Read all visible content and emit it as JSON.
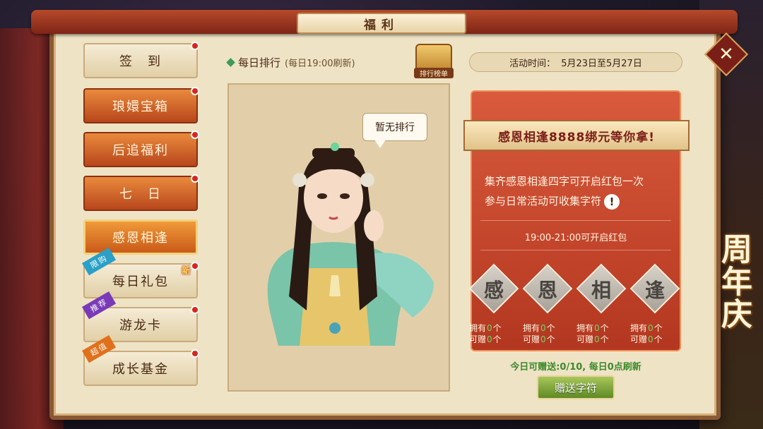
{
  "window": {
    "title": "福利"
  },
  "sidebar": {
    "items": [
      {
        "label": "签　到",
        "style": "plain",
        "dot": true,
        "tag": "",
        "new": false
      },
      {
        "label": "琅嬛宝箱",
        "style": "orange",
        "dot": true,
        "tag": "",
        "new": false
      },
      {
        "label": "后追福利",
        "style": "orange",
        "dot": true,
        "tag": "",
        "new": false
      },
      {
        "label": "七　日",
        "style": "orange",
        "dot": true,
        "tag": "",
        "new": false
      },
      {
        "label": "感恩相逢",
        "style": "active",
        "dot": false,
        "tag": "",
        "new": false
      },
      {
        "label": "每日礼包",
        "style": "plain",
        "dot": true,
        "tag": "限购",
        "tag_color": "#2aa0c8",
        "new": true,
        "new_label": "新"
      },
      {
        "label": "游龙卡",
        "style": "plain",
        "dot": true,
        "tag": "推荐",
        "tag_color": "#7a3ab8",
        "new": false
      },
      {
        "label": "成长基金",
        "style": "plain",
        "dot": true,
        "tag": "超值",
        "tag_color": "#e0701c",
        "new": false
      }
    ]
  },
  "ranking": {
    "header": "每日排行",
    "subheader": "(每日19:00刷新)",
    "rank_list_label": "排行榜单",
    "empty_text": "暂无排行"
  },
  "activity": {
    "time_label": "活动时间：",
    "time_value": "5月23日至5月27日",
    "banner": "感恩相逢8888绑元等你拿!",
    "desc_line1": "集齐感恩相逢四字可开启红包一次",
    "desc_line2": "参与日常活动可收集字符",
    "open_time": "19:00-21:00可开启红包",
    "chars": [
      {
        "glyph": "感",
        "own_label": "拥有",
        "own": 0,
        "gift_label": "可赠",
        "gift": 0,
        "unit": "个"
      },
      {
        "glyph": "恩",
        "own_label": "拥有",
        "own": 0,
        "gift_label": "可赠",
        "gift": 0,
        "unit": "个"
      },
      {
        "glyph": "相",
        "own_label": "拥有",
        "own": 0,
        "gift_label": "可赠",
        "gift": 0,
        "unit": "个"
      },
      {
        "glyph": "逢",
        "own_label": "拥有",
        "own": 0,
        "gift_label": "可赠",
        "gift": 0,
        "unit": "个"
      }
    ],
    "gift_info": "今日可赠送:0/10, 每日0点刷新",
    "gift_button": "赠送字符"
  },
  "decor": {
    "anniversary_text": "周年庆"
  },
  "icons": {
    "close": "close-icon",
    "info": "info-icon",
    "diamond": "diamond-bullet-icon",
    "rank": "rank-scroll-icon"
  },
  "colors": {
    "accent_red": "#b33720",
    "gift_green": "#3c8a2a",
    "dot_red": "#d8261c"
  }
}
